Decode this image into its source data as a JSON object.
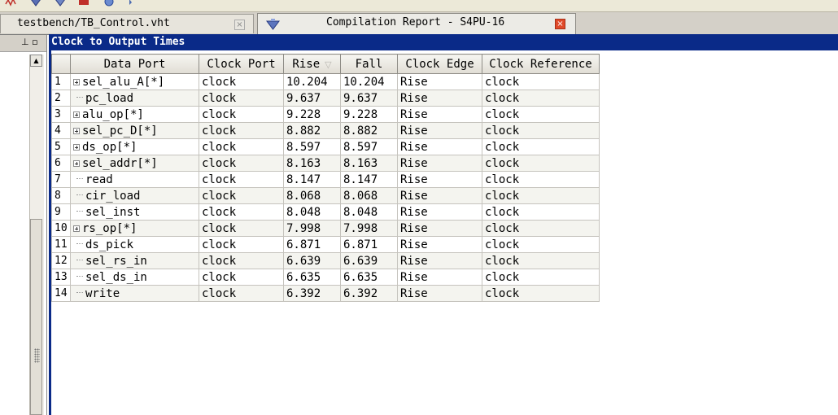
{
  "tabs": [
    {
      "label": "testbench/TB_Control.vht",
      "close": "×"
    },
    {
      "label": "Compilation Report - S4PU-16",
      "close": "×"
    }
  ],
  "panel_controls": "⊥ ▫",
  "report": {
    "title": "Clock to Output Times",
    "columns": [
      "Data Port",
      "Clock Port",
      "Rise",
      "Fall",
      "Clock Edge",
      "Clock Reference"
    ],
    "sort_indicator": "▽",
    "rows": [
      {
        "num": "1",
        "port": "sel_alu_A[*]",
        "expandable": true,
        "clock": "clock",
        "rise": "10.204",
        "fall": "10.204",
        "edge": "Rise",
        "ref": "clock"
      },
      {
        "num": "2",
        "port": "pc_load",
        "expandable": false,
        "clock": "clock",
        "rise": "9.637",
        "fall": "9.637",
        "edge": "Rise",
        "ref": "clock"
      },
      {
        "num": "3",
        "port": "alu_op[*]",
        "expandable": true,
        "clock": "clock",
        "rise": "9.228",
        "fall": "9.228",
        "edge": "Rise",
        "ref": "clock"
      },
      {
        "num": "4",
        "port": "sel_pc_D[*]",
        "expandable": true,
        "clock": "clock",
        "rise": "8.882",
        "fall": "8.882",
        "edge": "Rise",
        "ref": "clock"
      },
      {
        "num": "5",
        "port": "ds_op[*]",
        "expandable": true,
        "clock": "clock",
        "rise": "8.597",
        "fall": "8.597",
        "edge": "Rise",
        "ref": "clock"
      },
      {
        "num": "6",
        "port": "sel_addr[*]",
        "expandable": true,
        "clock": "clock",
        "rise": "8.163",
        "fall": "8.163",
        "edge": "Rise",
        "ref": "clock"
      },
      {
        "num": "7",
        "port": "read",
        "expandable": false,
        "clock": "clock",
        "rise": "8.147",
        "fall": "8.147",
        "edge": "Rise",
        "ref": "clock"
      },
      {
        "num": "8",
        "port": "cir_load",
        "expandable": false,
        "clock": "clock",
        "rise": "8.068",
        "fall": "8.068",
        "edge": "Rise",
        "ref": "clock"
      },
      {
        "num": "9",
        "port": "sel_inst",
        "expandable": false,
        "clock": "clock",
        "rise": "8.048",
        "fall": "8.048",
        "edge": "Rise",
        "ref": "clock"
      },
      {
        "num": "10",
        "port": "rs_op[*]",
        "expandable": true,
        "clock": "clock",
        "rise": "7.998",
        "fall": "7.998",
        "edge": "Rise",
        "ref": "clock"
      },
      {
        "num": "11",
        "port": "ds_pick",
        "expandable": false,
        "clock": "clock",
        "rise": "6.871",
        "fall": "6.871",
        "edge": "Rise",
        "ref": "clock"
      },
      {
        "num": "12",
        "port": "sel_rs_in",
        "expandable": false,
        "clock": "clock",
        "rise": "6.639",
        "fall": "6.639",
        "edge": "Rise",
        "ref": "clock"
      },
      {
        "num": "13",
        "port": "sel_ds_in",
        "expandable": false,
        "clock": "clock",
        "rise": "6.635",
        "fall": "6.635",
        "edge": "Rise",
        "ref": "clock"
      },
      {
        "num": "14",
        "port": "write",
        "expandable": false,
        "clock": "clock",
        "rise": "6.392",
        "fall": "6.392",
        "edge": "Rise",
        "ref": "clock"
      }
    ]
  },
  "colors": {
    "title_bar": "#0a2a88",
    "close_red": "#e04a2a"
  }
}
